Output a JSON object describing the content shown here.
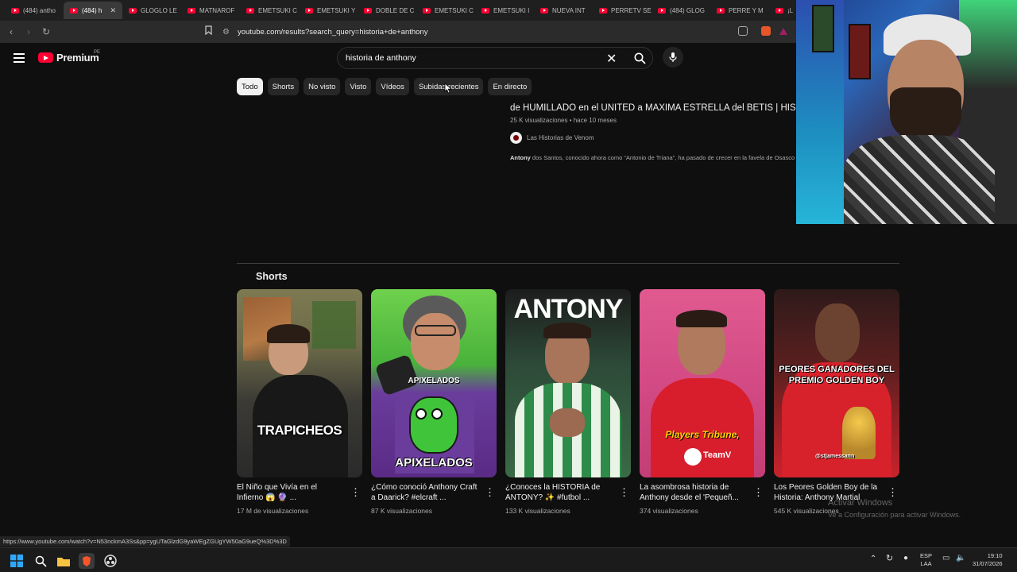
{
  "browser": {
    "tabs": [
      {
        "label": "(484) antho"
      },
      {
        "label": "(484) h"
      },
      {
        "label": "GLOGLO LE"
      },
      {
        "label": "MATNAROF"
      },
      {
        "label": "EMETSUKI C"
      },
      {
        "label": "EMETSUKI Y"
      },
      {
        "label": "DOBLE DE C"
      },
      {
        "label": "EMETSUKI C"
      },
      {
        "label": "EMETSUKI I"
      },
      {
        "label": "NUEVA INT"
      },
      {
        "label": "PERRETV SE"
      },
      {
        "label": "(484) GLOG"
      },
      {
        "label": "PERRE Y M"
      },
      {
        "label": "¡L"
      }
    ],
    "url": "youtube.com/results?search_query=historia+de+anthony"
  },
  "header": {
    "logo": "Premium",
    "country": "PE",
    "search_value": "historia de anthony"
  },
  "chips": [
    "Todo",
    "Shorts",
    "No visto",
    "Visto",
    "Vídeos",
    "Subidas recientes",
    "En directo"
  ],
  "result": {
    "title": "de HUMILLADO en el UNITED a MÁXIMA ESTRELLA del BETIS | HISTORIA",
    "meta": "25 K visualizaciones • hace 10 meses",
    "channel": "Las Historias de Venom",
    "snippet_bold": "Antony",
    "snippet": " dos Santos, conocido ahora como “Antonio de Triana”, ha pasado de crecer en la favela de Osasco"
  },
  "shorts": {
    "heading": "Shorts",
    "items": [
      {
        "title": "El Niño que Vivía en el Infierno 😱 🔮 ...",
        "views": "17 M de visualizaciones",
        "overlay": "TRAPICHEOS"
      },
      {
        "title": "¿Cómo conoció Anthony Craft a Daarick? #elcraft ...",
        "views": "87 K visualizaciones",
        "overlay": "APIXELADOS"
      },
      {
        "title": "¿Conoces la HISTORIA de ANTONY? ✨ #futbol ...",
        "views": "133 K visualizaciones",
        "overlay": "ANTONY"
      },
      {
        "title": "La asombrosa historia de Anthony desde el 'Pequeñ...",
        "views": "374 visualizaciones",
        "overlay": "Players Tribune,"
      },
      {
        "title": "Los Peores Golden Boy de la Historia: Anthony Martial",
        "views": "545 K visualizaciones",
        "overlay": "PEORES GANADORES DEL PREMIO GOLDEN BOY",
        "handle": "@stjamessann"
      }
    ]
  },
  "watermark": {
    "line1": "Activar Windows",
    "line2": "Ve a Configuración para activar Windows."
  },
  "status_url": "https://www.youtube.com/watch?v=N53nckmA3Ss&pp=ygUTaGlzdG9yaWEgZGUgYW50aG9ueQ%3D%3D",
  "taskbar": {
    "lang_top": "ESP",
    "lang_bottom": "LAA",
    "time": "19:10",
    "date": "31/07/2026"
  }
}
